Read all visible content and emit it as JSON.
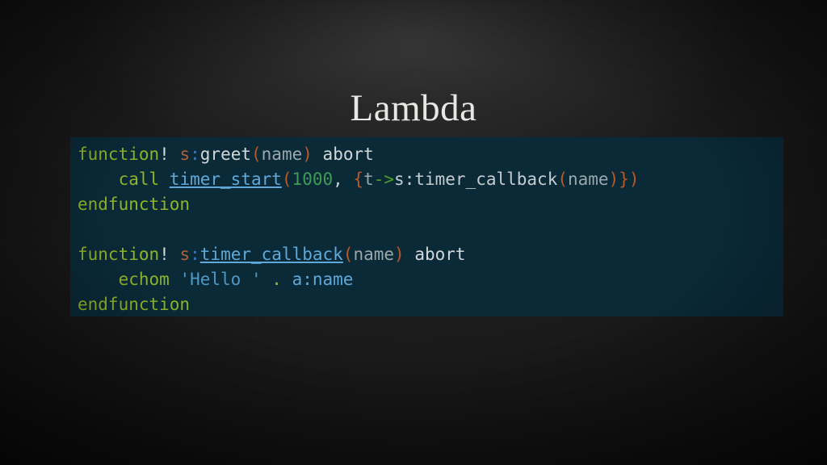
{
  "slide": {
    "title": "Lambda",
    "background_color": "#0d0d0d",
    "title_color": "#e8e7e4"
  },
  "code_block": {
    "background_color": "#0a2a38",
    "language": "vim",
    "raw_text": "function! s:greet(name) abort\n    call timer_start(1000, {t->s:timer_callback(name)})\nendfunction\n\nfunction! s:timer_callback(name) abort\n    echom 'Hello ' . a:name\nendfunction",
    "lines": [
      {
        "index": 1,
        "text": "function! s:greet(name) abort",
        "tokens": [
          {
            "t": "function",
            "k": "keyword"
          },
          {
            "t": "!",
            "k": "bang"
          },
          {
            "t": " ",
            "k": "plain"
          },
          {
            "t": "s",
            "k": "scope"
          },
          {
            "t": ":",
            "k": "colon"
          },
          {
            "t": "greet",
            "k": "funcname"
          },
          {
            "t": "(",
            "k": "paren"
          },
          {
            "t": "name",
            "k": "arg"
          },
          {
            "t": ")",
            "k": "paren"
          },
          {
            "t": " ",
            "k": "plain"
          },
          {
            "t": "abort",
            "k": "plain"
          }
        ]
      },
      {
        "index": 2,
        "text": "    call timer_start(1000, {t->s:timer_callback(name)})",
        "tokens": [
          {
            "t": "    ",
            "k": "plain"
          },
          {
            "t": "call",
            "k": "keyword"
          },
          {
            "t": " ",
            "k": "plain"
          },
          {
            "t": "timer_start",
            "k": "func-link"
          },
          {
            "t": "(",
            "k": "paren"
          },
          {
            "t": "1000",
            "k": "number"
          },
          {
            "t": ",",
            "k": "comma"
          },
          {
            "t": " ",
            "k": "plain"
          },
          {
            "t": "{",
            "k": "brace"
          },
          {
            "t": "t",
            "k": "arg"
          },
          {
            "t": "->",
            "k": "arrow"
          },
          {
            "t": "s:timer_callback",
            "k": "ident"
          },
          {
            "t": "(",
            "k": "paren"
          },
          {
            "t": "name",
            "k": "arg"
          },
          {
            "t": ")",
            "k": "paren"
          },
          {
            "t": "}",
            "k": "brace"
          },
          {
            "t": ")",
            "k": "paren"
          }
        ]
      },
      {
        "index": 3,
        "text": "endfunction",
        "tokens": [
          {
            "t": "endfunction",
            "k": "keyword"
          }
        ]
      },
      {
        "index": 4,
        "text": "",
        "tokens": []
      },
      {
        "index": 5,
        "text": "function! s:timer_callback(name) abort",
        "tokens": [
          {
            "t": "function",
            "k": "keyword"
          },
          {
            "t": "!",
            "k": "bang"
          },
          {
            "t": " ",
            "k": "plain"
          },
          {
            "t": "s",
            "k": "scope"
          },
          {
            "t": ":",
            "k": "colon"
          },
          {
            "t": "timer_callback",
            "k": "func-link"
          },
          {
            "t": "(",
            "k": "paren"
          },
          {
            "t": "name",
            "k": "arg"
          },
          {
            "t": ")",
            "k": "paren"
          },
          {
            "t": " ",
            "k": "plain"
          },
          {
            "t": "abort",
            "k": "plain"
          }
        ]
      },
      {
        "index": 6,
        "text": "    echom 'Hello ' . a:name",
        "tokens": [
          {
            "t": "    ",
            "k": "plain"
          },
          {
            "t": "echom",
            "k": "keyword"
          },
          {
            "t": " ",
            "k": "plain"
          },
          {
            "t": "'Hello '",
            "k": "string"
          },
          {
            "t": " ",
            "k": "plain"
          },
          {
            "t": ".",
            "k": "operator"
          },
          {
            "t": " ",
            "k": "plain"
          },
          {
            "t": "a:name",
            "k": "var"
          }
        ]
      },
      {
        "index": 7,
        "text": "endfunction",
        "tokens": [
          {
            "t": "endfunction",
            "k": "keyword"
          }
        ]
      }
    ]
  },
  "palette": {
    "keyword": "#8fb52a",
    "bang": "#d6dadc",
    "scope": "#b0603a",
    "colon": "#3a76c4",
    "funcname": "#d2d8da",
    "func-link": "#5fa8d8",
    "paren": "#b85a28",
    "arg": "#9aa7ab",
    "number": "#3e9c55",
    "comma": "#c9cfd2",
    "brace": "#b85a28",
    "arrow": "#4f9e28",
    "ident": "#c5ccd0",
    "string": "#4f98c4",
    "operator": "#9fb82a",
    "var": "#5fa8d8",
    "plain": "#d2d8da"
  }
}
